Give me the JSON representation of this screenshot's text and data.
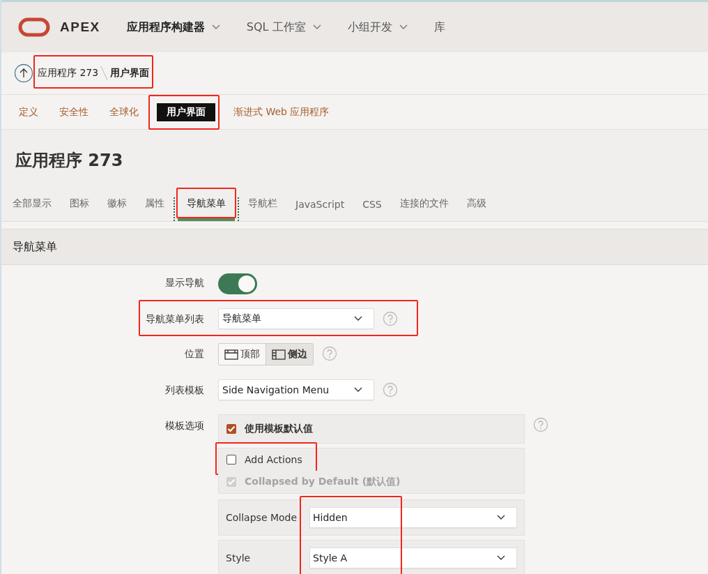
{
  "header": {
    "brand": "APEX",
    "menu": [
      {
        "label": "应用程序构建器",
        "selected": true,
        "dropdown": true
      },
      {
        "label": "SQL 工作室",
        "selected": false,
        "dropdown": true
      },
      {
        "label": "小组开发",
        "selected": false,
        "dropdown": true
      },
      {
        "label": "库",
        "selected": false
      }
    ]
  },
  "breadcrumb": {
    "items": [
      "应用程序 273",
      "用户界面"
    ],
    "highlighted": true
  },
  "tabs": [
    {
      "label": "定义",
      "selected": false
    },
    {
      "label": "安全性",
      "selected": false
    },
    {
      "label": "全球化",
      "selected": false
    },
    {
      "label": "用户界面",
      "selected": true,
      "highlighted": true
    },
    {
      "label": "渐进式 Web 应用程序",
      "selected": false
    }
  ],
  "page_title": "应用程序 273",
  "subtabs": [
    {
      "label": "全部显示",
      "selected": false
    },
    {
      "label": "图标",
      "selected": false
    },
    {
      "label": "徽标",
      "selected": false
    },
    {
      "label": "属性",
      "selected": false
    },
    {
      "label": "导航菜单",
      "selected": true,
      "highlighted": true
    },
    {
      "label": "导航栏",
      "selected": false
    },
    {
      "label": "JavaScript",
      "selected": false
    },
    {
      "label": "CSS",
      "selected": false
    },
    {
      "label": "连接的文件",
      "selected": false
    },
    {
      "label": "高级",
      "selected": false
    }
  ],
  "section_title": "导航菜单",
  "fields": [
    {
      "kind": "switch",
      "label": "显示导航",
      "on": true
    },
    {
      "kind": "select",
      "label": "导航菜单列表",
      "value": "导航菜单",
      "highlighted": true
    },
    {
      "kind": "segmented",
      "label": "位置",
      "options": [
        {
          "label": "顶部",
          "selected": false
        },
        {
          "label": "侧边",
          "selected": true
        }
      ]
    },
    {
      "kind": "select",
      "label": "列表模板",
      "value": "Side Navigation Menu"
    },
    {
      "kind": "options",
      "label": "模板选项",
      "checks": [
        {
          "label": "使用模板默认值",
          "checked": true
        },
        {
          "label": "Add Actions",
          "checked": false,
          "highlighted": true
        },
        {
          "label": "Collapsed by Default (默认值)",
          "checked": true,
          "disabled": true
        }
      ],
      "selects": [
        {
          "label": "Collapse Mode",
          "value": "Hidden"
        },
        {
          "label": "Style",
          "value": "Style A"
        }
      ],
      "selects_highlighted": true
    }
  ]
}
